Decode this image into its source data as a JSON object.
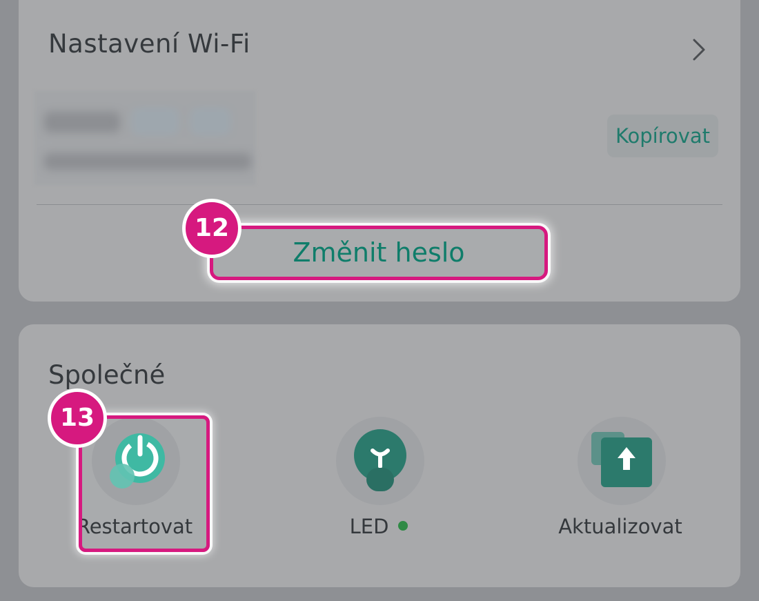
{
  "wifi_card": {
    "title": "Nastavení Wi-Fi",
    "copy_label": "Kopírovat",
    "change_password_label": "Změnit heslo",
    "callout_number": "12"
  },
  "common_card": {
    "title": "Společné",
    "callout_number": "13",
    "actions": [
      {
        "label": "Restartovat",
        "icon": "power-restart-icon"
      },
      {
        "label": "LED",
        "icon": "lightbulb-icon",
        "status": "on"
      },
      {
        "label": "Aktualizovat",
        "icon": "update-arrow-icon"
      }
    ]
  },
  "colors": {
    "accent_teal": "#2a8a78",
    "callout_magenta": "#d6197f",
    "led_on": "#2f8a45"
  }
}
